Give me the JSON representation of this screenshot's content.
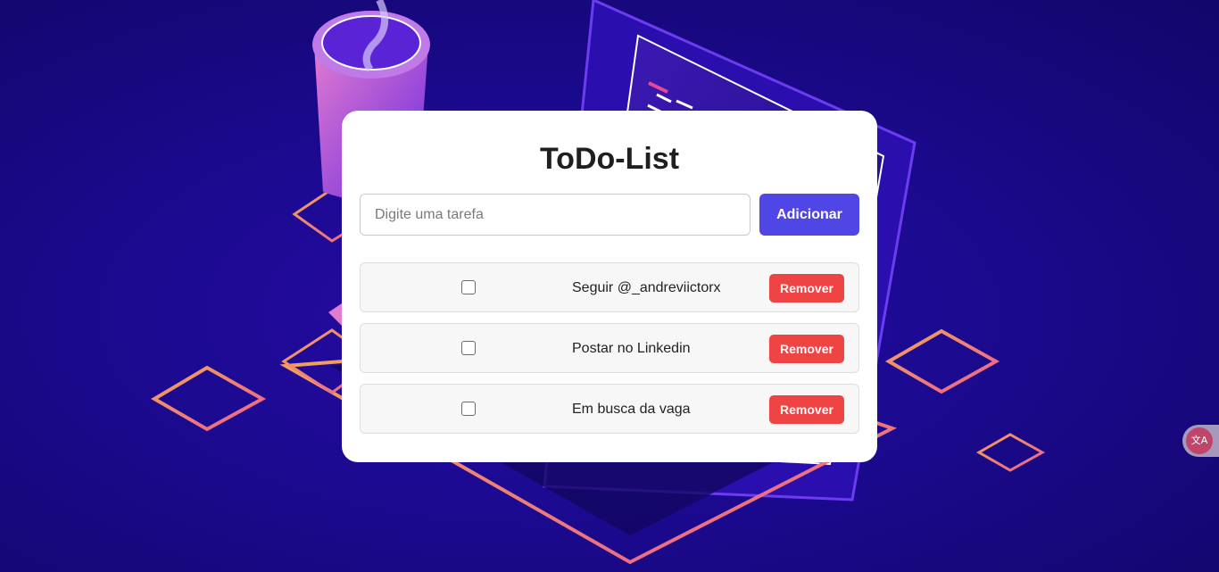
{
  "app": {
    "title": "ToDo-List"
  },
  "form": {
    "placeholder": "Digite uma tarefa",
    "value": "",
    "add_label": "Adicionar"
  },
  "tasks": [
    {
      "text": "Seguir @_andreviictorx",
      "done": false,
      "remove_label": "Remover"
    },
    {
      "text": "Postar no Linkedin",
      "done": false,
      "remove_label": "Remover"
    },
    {
      "text": "Em busca da vaga",
      "done": false,
      "remove_label": "Remover"
    }
  ],
  "widgets": {
    "translate_icon": "translate-icon"
  },
  "colors": {
    "accent": "#4f46e5",
    "danger": "#ef4444",
    "background": "#1c0a92"
  }
}
